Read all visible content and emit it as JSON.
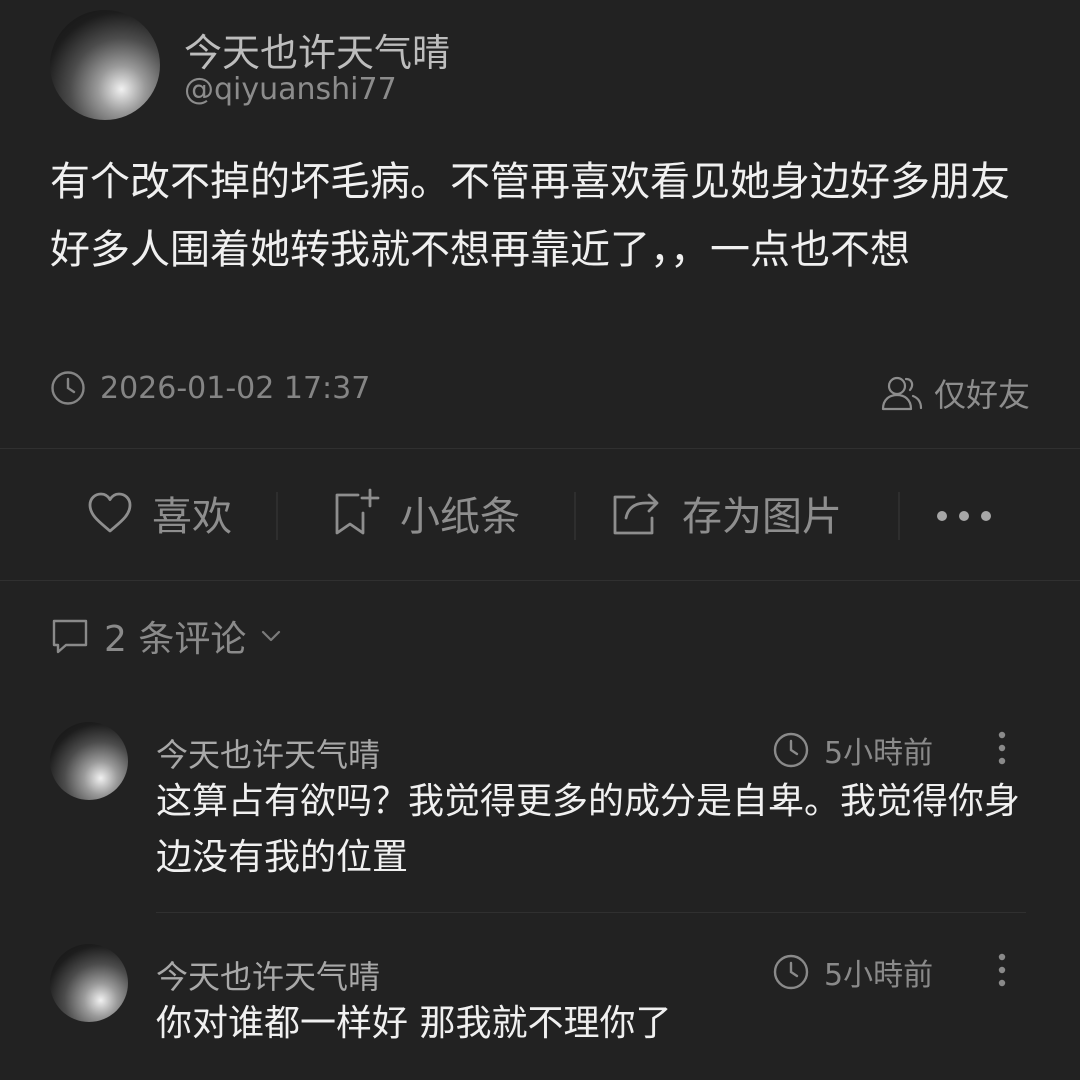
{
  "post": {
    "author": {
      "display_name": "今天也许天气晴",
      "handle": "@qiyuanshi77"
    },
    "text": "有个改不掉的坏毛病。不管再喜欢看见她身边好多朋友好多人围着她转我就不想再靠近了，，一点也不想",
    "timestamp": "2026-01-02 17:37",
    "visibility": "仅好友",
    "icons": {
      "time": "clock-icon",
      "visibility": "friends-icon"
    }
  },
  "actions": [
    {
      "label": "喜欢",
      "icon": "heart-icon"
    },
    {
      "label": "小纸条",
      "icon": "bookmark-add-icon"
    },
    {
      "label": "存为图片",
      "icon": "share-export-icon"
    },
    {
      "label": "",
      "icon": "more-horizontal-icon"
    }
  ],
  "comments_section": {
    "count_label": "2 条评论",
    "icon": "comment-icon",
    "toggle_icon": "chevron-down-icon"
  },
  "comments": [
    {
      "author": "今天也许天气晴",
      "time": "5小時前",
      "text": "这算占有欲吗？我觉得更多的成分是自卑。我觉得你身边没有我的位置"
    },
    {
      "author": "今天也许天气晴",
      "time": "5小時前",
      "text": "你对谁都一样好 那我就不理你了"
    }
  ],
  "colors": {
    "background": "#222222",
    "primary_text": "#f0f0f0",
    "secondary_text": "#8a8a8a",
    "divider": "#303030"
  }
}
